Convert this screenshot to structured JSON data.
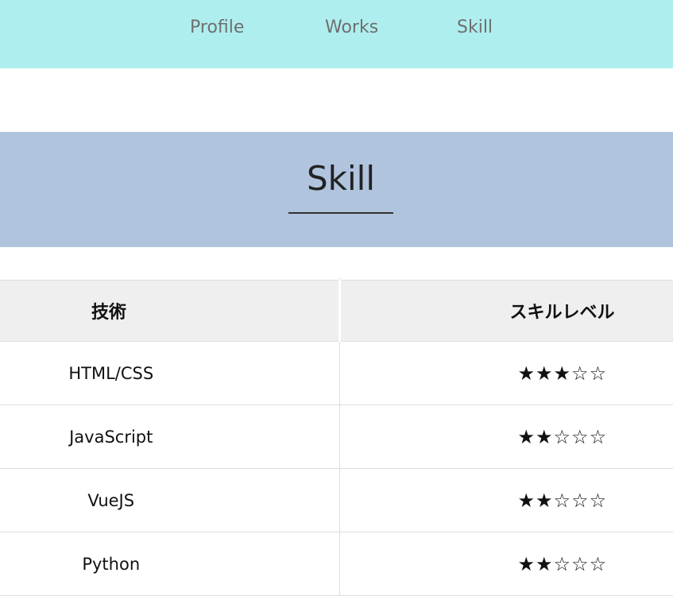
{
  "nav": {
    "items": [
      {
        "label": "Profile"
      },
      {
        "label": "Works"
      },
      {
        "label": "Skill"
      }
    ]
  },
  "section": {
    "title": "Skill"
  },
  "table": {
    "headers": {
      "tech": "技術",
      "level": "スキルレベル"
    },
    "rows": [
      {
        "tech": "HTML/CSS",
        "stars": "★★★☆☆",
        "rating": 3
      },
      {
        "tech": "JavaScript",
        "stars": "★★☆☆☆",
        "rating": 2
      },
      {
        "tech": "VueJS",
        "stars": "★★☆☆☆",
        "rating": 2
      },
      {
        "tech": "Python",
        "stars": "★★☆☆☆",
        "rating": 2
      }
    ]
  },
  "colors": {
    "nav_background": "#afeeee",
    "section_background": "#b0c4de",
    "header_row_background": "#efefef",
    "nav_text": "#6f6f6f"
  }
}
